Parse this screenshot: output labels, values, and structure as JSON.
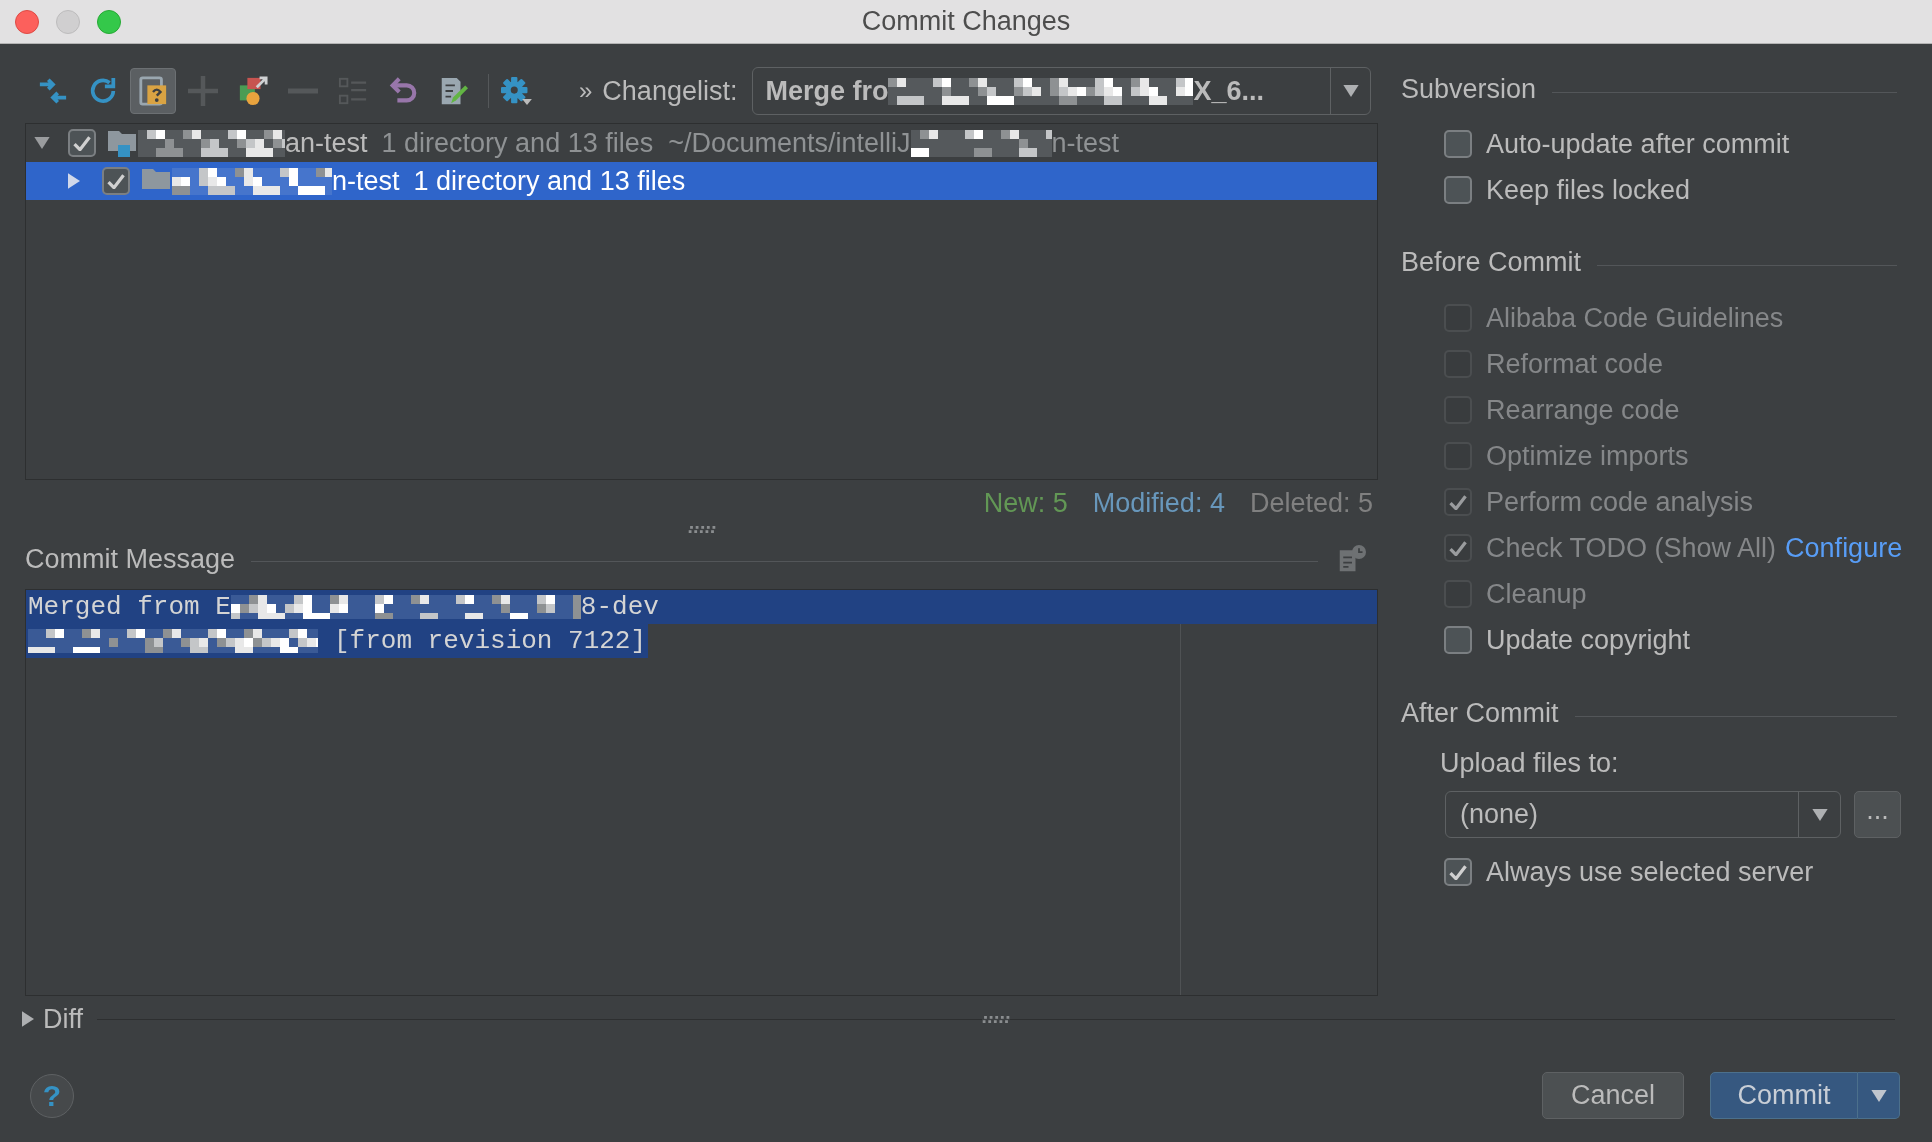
{
  "window": {
    "title": "Commit Changes",
    "controls": [
      {
        "kind": "close",
        "disabled": false
      },
      {
        "kind": "minimize",
        "disabled": true
      },
      {
        "kind": "zoom",
        "disabled": false
      }
    ]
  },
  "toolbar": {
    "items": [
      {
        "kind": "button",
        "pressed": false,
        "disabled": false
      },
      {
        "kind": "button",
        "pressed": false,
        "disabled": false
      },
      {
        "kind": "button",
        "pressed": true,
        "disabled": false
      },
      {
        "kind": "button",
        "pressed": false,
        "disabled": true
      },
      {
        "kind": "button",
        "pressed": false,
        "disabled": false
      },
      {
        "kind": "button",
        "pressed": false,
        "disabled": true
      },
      {
        "kind": "button",
        "pressed": false,
        "disabled": true
      },
      {
        "kind": "button",
        "pressed": false,
        "disabled": false
      },
      {
        "kind": "button",
        "pressed": false,
        "disabled": false
      },
      {
        "kind": "separator"
      },
      {
        "kind": "button",
        "pressed": false,
        "disabled": false
      }
    ],
    "overflow": "»",
    "changelist_label": "Changelist:",
    "changelist": {
      "value_start": "Merge fro",
      "value_end": "X_6..."
    }
  },
  "changes_tree": [
    {
      "name": "an-test",
      "summary": "1 directory and 13 files",
      "path_start": "~/Documents/intelliJ",
      "path_end": "n-test",
      "expanded": true,
      "checked": true,
      "selected": false,
      "children": [
        {
          "name": "n-test",
          "summary": "1 directory and 13 files",
          "expanded": false,
          "checked": true,
          "selected": true
        }
      ]
    }
  ],
  "change_counts": [
    {
      "text": "New: 5",
      "color": "#629755"
    },
    {
      "text": "Modified: 4",
      "color": "#6897bb"
    },
    {
      "text": "Deleted: 5",
      "color": "#808080"
    }
  ],
  "commit_message": {
    "label": "Commit Message",
    "lines": [
      {
        "selected": true,
        "segments": [
          {
            "kind": "text",
            "text": "Merged from E"
          },
          {
            "kind": "redacted"
          },
          {
            "kind": "text",
            "text": "8-dev"
          }
        ]
      },
      {
        "selected": true,
        "segments": [
          {
            "kind": "redacted"
          },
          {
            "kind": "text",
            "text": "[from revision 7122]"
          }
        ]
      }
    ]
  },
  "subversion": {
    "title": "Subversion",
    "options": [
      {
        "label": "Auto-update after commit",
        "checked": false,
        "disabled": false
      },
      {
        "label": "Keep files locked",
        "checked": false,
        "disabled": false
      }
    ]
  },
  "before_commit": {
    "title": "Before Commit",
    "options": [
      {
        "label": "Alibaba Code Guidelines",
        "checked": false,
        "disabled": true
      },
      {
        "label": "Reformat code",
        "checked": false,
        "disabled": true
      },
      {
        "label": "Rearrange code",
        "checked": false,
        "disabled": true
      },
      {
        "label": "Optimize imports",
        "checked": false,
        "disabled": true
      },
      {
        "label": "Perform code analysis",
        "checked": true,
        "disabled": true
      },
      {
        "label": "Check TODO (Show All)",
        "checked": true,
        "disabled": true,
        "link": "Configure"
      },
      {
        "label": "Cleanup",
        "checked": false,
        "disabled": true
      },
      {
        "label": "Update copyright",
        "checked": false,
        "disabled": false
      }
    ]
  },
  "after_commit": {
    "title": "After Commit",
    "upload_label": "Upload files to:",
    "upload_target": {
      "value": "(none)"
    },
    "browse_button": "...",
    "options": [
      {
        "label": "Always use selected server",
        "checked": true,
        "disabled": false
      }
    ]
  },
  "diff": {
    "label": "Diff",
    "expanded": false
  },
  "help_button": "?",
  "buttons": [
    {
      "label": "Cancel",
      "kind": "plain"
    },
    {
      "label": "Commit",
      "kind": "default_split"
    }
  ]
}
